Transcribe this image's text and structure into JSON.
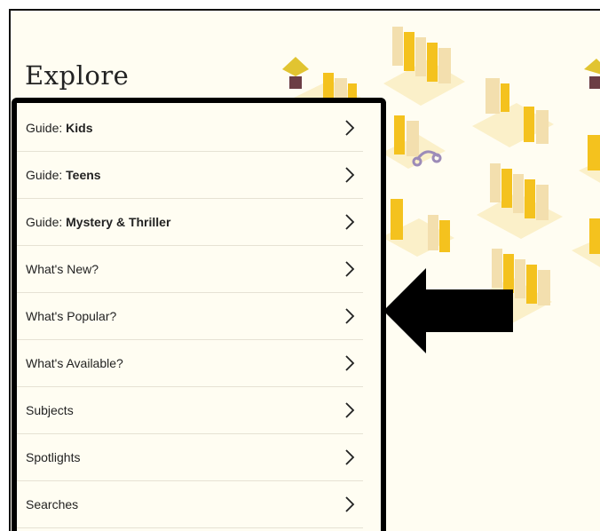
{
  "page": {
    "title": "Explore"
  },
  "menu": {
    "items": [
      {
        "prefix": "Guide: ",
        "bold": "Kids",
        "label": ""
      },
      {
        "prefix": "Guide: ",
        "bold": "Teens",
        "label": ""
      },
      {
        "prefix": "Guide: ",
        "bold": "Mystery & Thriller",
        "label": ""
      },
      {
        "prefix": "",
        "bold": "",
        "label": "What's New?"
      },
      {
        "prefix": "",
        "bold": "",
        "label": "What's Popular?"
      },
      {
        "prefix": "",
        "bold": "",
        "label": "What's Available?"
      },
      {
        "prefix": "",
        "bold": "",
        "label": "Subjects"
      },
      {
        "prefix": "",
        "bold": "",
        "label": "Spotlights"
      },
      {
        "prefix": "",
        "bold": "",
        "label": "Searches"
      }
    ]
  },
  "colors": {
    "background": "#fffdf2",
    "book_yellow": "#f4c21e",
    "book_cream": "#f3dfae",
    "shelf": "#fbf0c9",
    "annotation": "#000000"
  }
}
